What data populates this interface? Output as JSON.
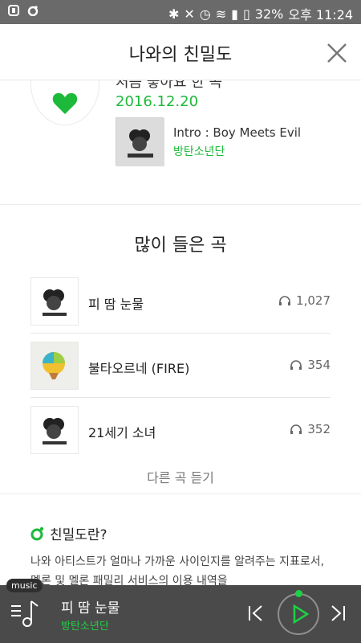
{
  "status_bar": {
    "battery": "32%",
    "time": "오후 11:24"
  },
  "header": {
    "title": "나와의 친밀도"
  },
  "top": {
    "cut_text": "처음 좋아요 한 곡",
    "date": "2016.12.20",
    "track_title": "Intro : Boy Meets Evil",
    "track_artist": "방탄소년단"
  },
  "most_played": {
    "title": "많이 들은 곡",
    "songs": [
      {
        "name": "피 땀 눈물",
        "plays": "1,027"
      },
      {
        "name": "불타오르네 (FIRE)",
        "plays": "354"
      },
      {
        "name": "21세기 소녀",
        "plays": "352"
      }
    ],
    "more_label": "다른 곡 듣기"
  },
  "about": {
    "title": "친밀도란?",
    "desc": "나와 아티스트가 얼마나 가까운 사이인지를 알려주는 지표로서, 멜론 및 멜론 패밀리 서비스의 이용 내역을"
  },
  "player": {
    "tag": "music",
    "song": "피 땀 눈물",
    "artist": "방탄소년단"
  },
  "colors": {
    "accent": "#1db93a",
    "statusbar": "#6a6a6a",
    "player_bg": "#4a4a4a"
  }
}
